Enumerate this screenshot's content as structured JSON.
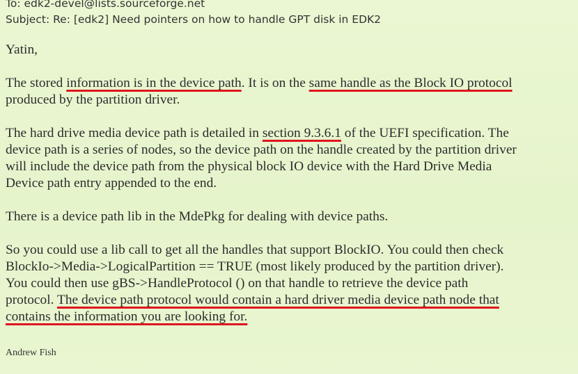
{
  "email": {
    "to_label": "To:",
    "to_value": "edk2-devel@lists.sourceforge.net",
    "subject_label": "Subject:",
    "subject_value": "Re: [edk2] Need pointers on how to handle GPT disk in EDK2",
    "greeting": "Yatin,",
    "p1": {
      "a": "The stored ",
      "u1": "information is in the device path",
      "b": ". It is on the ",
      "u2": "same handle as the Block IO protocol",
      "c": "produced by the partition driver."
    },
    "p2": {
      "a": "The hard drive media device path is detailed in ",
      "u1": "section 9.3.6.1",
      "b": " of the UEFI specification. The",
      "l2": "device path is a series of nodes, so the device path on the handle created by the partition driver",
      "l3": "will include the device path from the physical block IO device with the Hard Drive Media",
      "l4": "Device path entry appended to the end."
    },
    "p3": "There is a device path lib in the MdePkg for dealing with device paths.",
    "p4": {
      "l1": "So you could use a lib call to get all the handles that support BlockIO. You could then check",
      "l2": "BlockIo->Media->LogicalPartition == TRUE (most likely produced by the partition driver).",
      "l3": "You could then use gBS->HandleProtocol () on that handle to retrieve the device path",
      "l4a": "protocol. ",
      "u1": "The device path protocol would contain a hard driver media device path node that",
      "u2": "contains the information you are looking for."
    },
    "signature": "Andrew Fish",
    "highlight_color": "#e0141e",
    "background_color": "#e6f5cc"
  }
}
